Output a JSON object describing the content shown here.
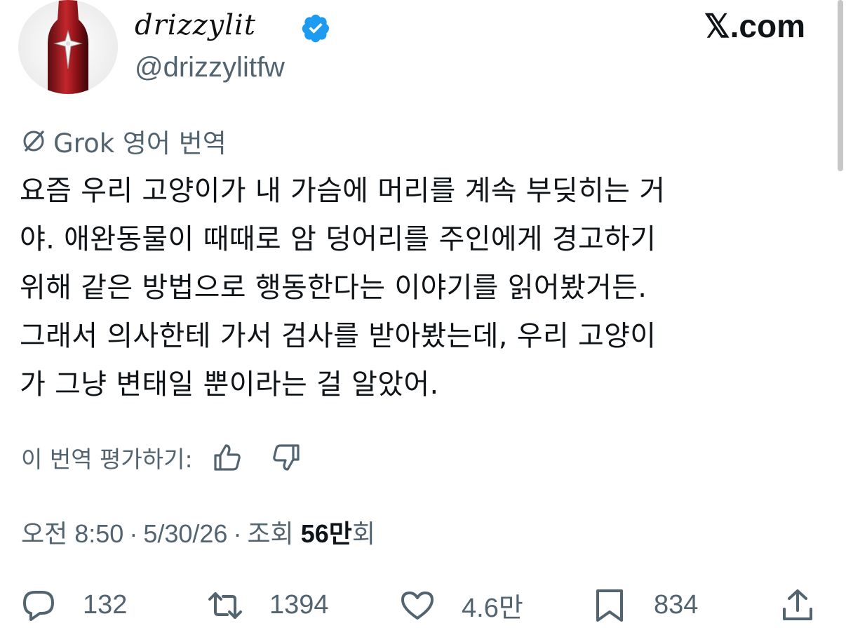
{
  "header": {
    "display_name": "drizzylit",
    "handle": "@drizzylitfw",
    "brand": "𝕏.com",
    "verified": true,
    "verified_color": "#1d9bf0"
  },
  "translation": {
    "label": "Grok 영어 번역",
    "icon": "grok-icon"
  },
  "tweet": {
    "lines": [
      "요즘 우리 고양이가 내 가슴에 머리를 계속 부딪히는 거",
      "야. 애완동물이 때때로 암 덩어리를 주인에게 경고하기",
      "위해 같은 방법으로 행동한다는 이야기를 읽어봤거든.",
      "그래서 의사한테 가서 검사를 받아봤는데, 우리 고양이",
      "가 그냥 변태일 뿐이라는 걸 알았어."
    ]
  },
  "rating": {
    "label": "이 번역 평가하기:",
    "up_icon": "thumbs-up-icon",
    "down_icon": "thumbs-down-icon"
  },
  "meta": {
    "time": "오전 8:50",
    "date": "5/30/26",
    "views_prefix": "조회",
    "views_count": "56만",
    "views_suffix": "회",
    "separator": "·"
  },
  "actions": {
    "replies": "132",
    "reposts": "1394",
    "likes": "4.6만",
    "bookmarks": "834"
  },
  "colors": {
    "text": "#0f1419",
    "secondary": "#536471",
    "verified": "#1d9bf0"
  }
}
